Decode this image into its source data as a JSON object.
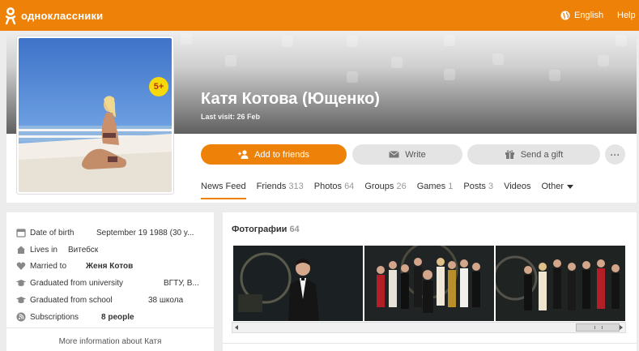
{
  "header": {
    "logo_text": "одноклассники",
    "lang_label": "English",
    "help_label": "Help",
    "brand_color": "#ee8208"
  },
  "profile": {
    "name": "Катя Котова (Ющенко)",
    "last_visit": "Last visit: 26 Feb",
    "badge": "5+",
    "buttons": {
      "add_friends": "Add to friends",
      "write": "Write",
      "gift": "Send a gift",
      "more": "···"
    },
    "tabs": [
      {
        "label": "News Feed",
        "count": ""
      },
      {
        "label": "Friends",
        "count": "313"
      },
      {
        "label": "Photos",
        "count": "64"
      },
      {
        "label": "Groups",
        "count": "26"
      },
      {
        "label": "Games",
        "count": "1"
      },
      {
        "label": "Posts",
        "count": "3"
      },
      {
        "label": "Videos",
        "count": ""
      },
      {
        "label": "Other",
        "count": ""
      }
    ]
  },
  "info": {
    "rows": [
      {
        "icon": "calendar-icon",
        "label": "Date of birth",
        "value": "September 19 1988 (30 y..."
      },
      {
        "icon": "home-icon",
        "label": "Lives in",
        "value": "Витебск"
      },
      {
        "icon": "heart-icon",
        "label": "Married to",
        "value": "Женя Котов"
      },
      {
        "icon": "graduation-cap-icon",
        "label": "Graduated from university",
        "value": "ВГТУ, В..."
      },
      {
        "icon": "graduation-cap-icon",
        "label": "Graduated from school",
        "value": "38 школа"
      },
      {
        "icon": "rss-icon",
        "label": "Subscriptions",
        "value": "8 people"
      }
    ],
    "more_link": "More information about Катя"
  },
  "photos": {
    "title": "Фотографии",
    "count": "64",
    "scroll_thumb_label": "|||"
  }
}
